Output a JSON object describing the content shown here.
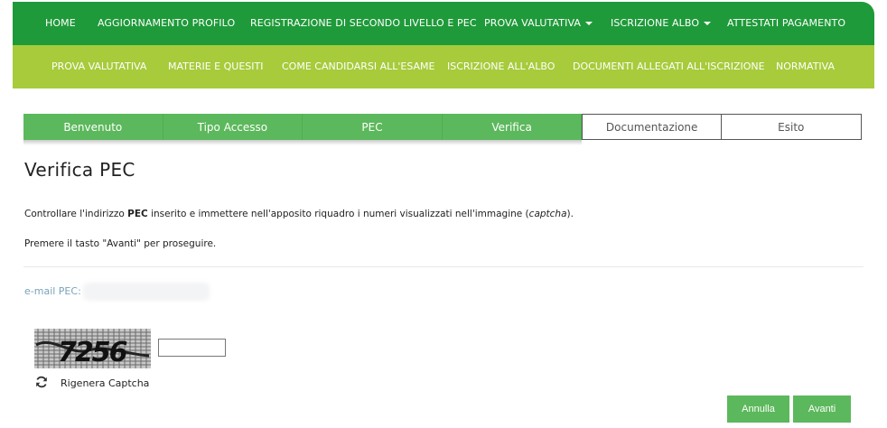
{
  "topnav": {
    "items": [
      {
        "label": "HOME"
      },
      {
        "label": "AGGIORNAMENTO PROFILO"
      },
      {
        "label": "REGISTRAZIONE DI SECONDO LIVELLO E PEC"
      },
      {
        "label": "PROVA VALUTATIVA"
      },
      {
        "label": "ISCRIZIONE ALBO"
      },
      {
        "label": "ATTESTATI PAGAMENTO"
      }
    ]
  },
  "subnav": {
    "items": [
      {
        "label": "PROVA VALUTATIVA"
      },
      {
        "label": "MATERIE E QUESITI"
      },
      {
        "label": "COME CANDIDARSI ALL'ESAME"
      },
      {
        "label": "ISCRIZIONE ALL'ALBO"
      },
      {
        "label": "DOCUMENTI ALLEGATI ALL'ISCRIZIONE"
      },
      {
        "label": "NORMATIVA"
      }
    ]
  },
  "steps": [
    {
      "label": "Benvenuto",
      "status": "done"
    },
    {
      "label": "Tipo Accesso",
      "status": "done"
    },
    {
      "label": "PEC",
      "status": "done"
    },
    {
      "label": "Verifica",
      "status": "current"
    },
    {
      "label": "Documentazione",
      "status": "todo"
    },
    {
      "label": "Esito",
      "status": "todo"
    }
  ],
  "page": {
    "title": "Verifica PEC",
    "instruction_pre": "Controllare l'indirizzo ",
    "instruction_bold": "PEC",
    "instruction_mid": " inserito e immettere nell'apposito riquadro i numeri visualizzati nell'immagine (",
    "instruction_italic": "captcha",
    "instruction_post": ").",
    "instruction2": "Premere il tasto \"Avanti\" per proseguire."
  },
  "pec": {
    "label": "e-mail PEC:",
    "value": ""
  },
  "captcha": {
    "code": "7256",
    "input_value": "",
    "regen_label": "Rigenera Captcha"
  },
  "actions": {
    "cancel_label": "Annulla",
    "next_label": "Avanti"
  },
  "colors": {
    "primary_green": "#1f9a3a",
    "lime": "#a7cb3b",
    "step_green": "#5cb85c",
    "pec_label": "#7aa2b8"
  }
}
